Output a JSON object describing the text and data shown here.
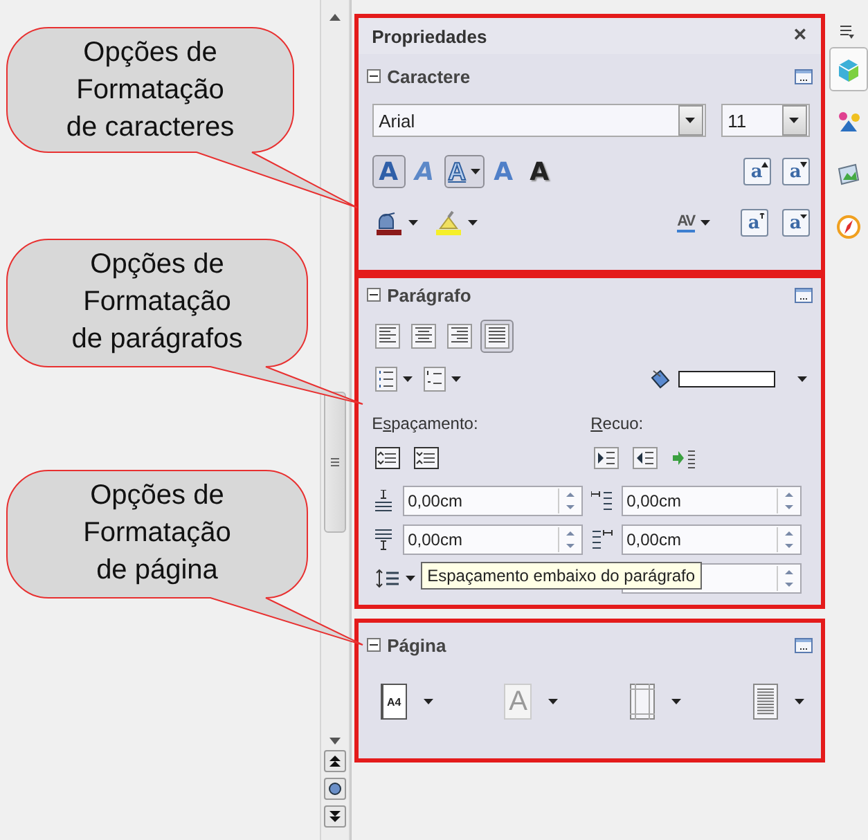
{
  "callouts": [
    {
      "text": "Opções de\nFormatação\nde caracteres"
    },
    {
      "text": "Opções de\nFormatação\nde parágrafos"
    },
    {
      "text": "Opções de\nFormatação\nde página"
    }
  ],
  "sidebar": {
    "title": "Propriedades",
    "close": "×",
    "character": {
      "title": "Caractere",
      "expanded": true,
      "font": "Arial",
      "size": "11",
      "format_buttons": [
        {
          "kind": "bold",
          "glyph": "A",
          "selected": true
        },
        {
          "kind": "italic",
          "glyph": "A",
          "selected": false
        },
        {
          "kind": "underline",
          "glyph": "A",
          "selected": true
        },
        {
          "kind": "strike",
          "glyph": "A",
          "selected": false
        },
        {
          "kind": "shadow",
          "glyph": "A",
          "selected": false
        }
      ],
      "size_buttons": [
        {
          "kind": "grow",
          "glyph": "a"
        },
        {
          "kind": "shrink",
          "glyph": "a"
        }
      ],
      "color_buttons": [
        {
          "kind": "font-color"
        },
        {
          "kind": "highlight"
        }
      ],
      "spacing_button": {
        "glyph": "AV"
      },
      "script_buttons": [
        {
          "kind": "superscript",
          "glyph": "a"
        },
        {
          "kind": "subscript",
          "glyph": "a"
        }
      ]
    },
    "paragraph": {
      "title": "Parágrafo",
      "expanded": true,
      "align_buttons": [
        {
          "kind": "left",
          "selected": false
        },
        {
          "kind": "center",
          "selected": false
        },
        {
          "kind": "right",
          "selected": false
        },
        {
          "kind": "justify",
          "selected": true
        }
      ],
      "list_buttons": [
        {
          "kind": "bullets"
        },
        {
          "kind": "numbering"
        }
      ],
      "spacing_label": {
        "before": "E",
        "key": "s",
        "after": "paçamento:"
      },
      "indent_label": {
        "key": "R",
        "after": "ecuo:"
      },
      "spacing_buttons": [
        {
          "kind": "increase"
        },
        {
          "kind": "decrease"
        }
      ],
      "indent_buttons": [
        {
          "kind": "increase"
        },
        {
          "kind": "decrease"
        },
        {
          "kind": "hanging"
        }
      ],
      "fields": [
        {
          "kind": "above",
          "value": "0,00cm"
        },
        {
          "kind": "before",
          "value": "0,00cm"
        },
        {
          "kind": "below",
          "value": "0,00cm"
        },
        {
          "kind": "after",
          "value": "0,00cm"
        },
        {
          "kind": "line-spacing"
        },
        {
          "kind": "first-line"
        }
      ],
      "tooltip": "Espaçamento embaixo do parágrafo"
    },
    "page": {
      "title": "Página",
      "expanded": true,
      "buttons": [
        {
          "kind": "size",
          "glyph": "A4"
        },
        {
          "kind": "orientation",
          "glyph": "A"
        },
        {
          "kind": "margins"
        },
        {
          "kind": "columns"
        }
      ]
    }
  },
  "tabs": [
    {
      "kind": "properties",
      "selected": true
    },
    {
      "kind": "styles",
      "selected": false
    },
    {
      "kind": "gallery",
      "selected": false
    },
    {
      "kind": "navigator",
      "selected": false
    }
  ]
}
